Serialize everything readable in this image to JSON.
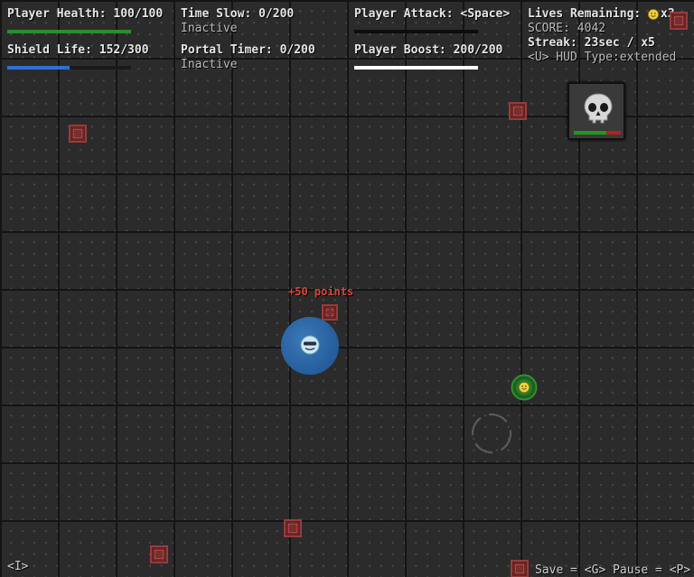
{
  "hud": {
    "health": {
      "label": "Player Health: 100/100",
      "fraction": 1.0,
      "color": "#2e8b2e"
    },
    "shield": {
      "label": "Shield Life: 152/300",
      "fraction": 0.507,
      "color": "#2f6fd1"
    },
    "time_slow": {
      "label": "Time Slow: 0/200",
      "status": "Inactive"
    },
    "portal": {
      "label": "Portal Timer: 0/200",
      "status": "Inactive"
    },
    "attack": {
      "label": "Player Attack: <Space>",
      "fraction": 0.0
    },
    "boost": {
      "label": "Player Boost: 200/200",
      "fraction": 1.0,
      "color": "#ffffff"
    },
    "lives": {
      "label": "Lives Remaining:",
      "count": "x3"
    },
    "score": "SCORE: 4042",
    "streak": "Streak: 23sec / x5",
    "hud_type": "<U> HUD Type:extended"
  },
  "floating_text": "+50 points",
  "boss_panel": {
    "icon": "skull-icon",
    "health_fraction": 0.7,
    "health_color": "#1e9a1e",
    "damage_color": "#b32020"
  },
  "bottom_bar": {
    "info_key": "<I>",
    "controls": "Save = <G> Pause = <P>"
  },
  "colors": {
    "crate": "#7a2e2e",
    "shield": "#2a6ab3",
    "enemy": "#2f8f2f",
    "background": "#2b2b2b"
  }
}
